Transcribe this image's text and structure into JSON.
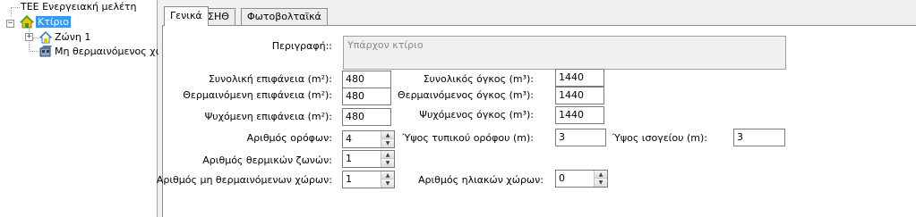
{
  "tree": {
    "root_label": "ΤΕΕ Ενεργειακή μελέτη",
    "building_label": "Κτίριο",
    "zone_label": "Ζώνη 1",
    "unheated_label": "Μη θερμαινόμενος χώ",
    "zone_expander": "+"
  },
  "tabs": [
    "Γενικά",
    "ΣΗΘ",
    "Φωτοβολταϊκά"
  ],
  "form": {
    "description_label": "Περιγραφή::",
    "description_value": "Υπάρχον κτίριο",
    "total_area_label": "Συνολική επιφάνεια (m²):",
    "total_area_value": "480",
    "heated_area_label": "Θερμαινόμενη επιφάνεια (m²):",
    "heated_area_value": "480",
    "cooled_area_label": "Ψυχόμενη επιφάνεια (m²):",
    "cooled_area_value": "480",
    "total_volume_label": "Συνολικός όγκος (m³):",
    "total_volume_value": "1440",
    "heated_volume_label": "Θερμαινόμενος όγκος (m³):",
    "heated_volume_value": "1440",
    "cooled_volume_label": "Ψυχόμενος όγκος (m³):",
    "cooled_volume_value": "1440",
    "floors_label": "Αριθμός ορόφων:",
    "floors_value": "4",
    "typical_height_label": "Ύψος τυπικού ορόφου (m):",
    "typical_height_value": "3",
    "ground_height_label": "Ύψος ισογείου (m):",
    "ground_height_value": "3",
    "thermal_zones_label": "Αριθμός θερμικών ζωνών:",
    "thermal_zones_value": "1",
    "unheated_spaces_label": "Αριθμός μη θερμαινόμενων χώρων:",
    "unheated_spaces_value": "1",
    "solar_spaces_label": "Αριθμός ηλιακών χώρων:",
    "solar_spaces_value": "0"
  },
  "icons": {
    "house": "house-icon",
    "zone": "zone-house-icon",
    "unheated": "unheated-space-icon",
    "spin_up": "▲",
    "spin_down": "▼"
  },
  "colors": {
    "selection": "#3399ff",
    "house_roof": "#2e9b2e",
    "house_wall": "#f2c200"
  }
}
